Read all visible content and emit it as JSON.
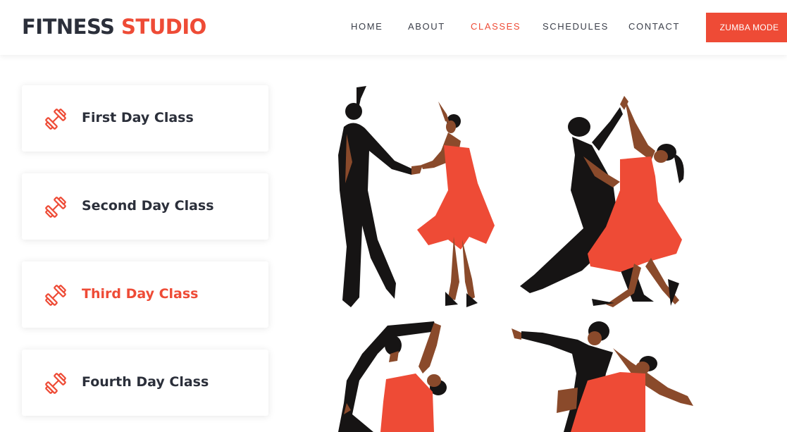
{
  "brand": {
    "word1": "FITNESS",
    "word2": "STUDIO"
  },
  "nav": {
    "items": [
      {
        "label": "HOME"
      },
      {
        "label": "ABOUT"
      },
      {
        "label": "CLASSES",
        "active": true
      },
      {
        "label": "SCHEDULES"
      },
      {
        "label": "CONTACT"
      }
    ],
    "cta_label": "ZUMBA MODE"
  },
  "classes": [
    {
      "label": "First Day Class"
    },
    {
      "label": "Second Day Class"
    },
    {
      "label": "Third Day Class",
      "active": true
    },
    {
      "label": "Fourth Day Class"
    }
  ],
  "illustration": {
    "icon": "dancing-couples-illustration"
  },
  "colors": {
    "accent": "#ee4b36",
    "text_dark": "#2b2f3a",
    "skin": "#8a4a2b",
    "dress": "#ee4b36",
    "suit": "#161414"
  }
}
